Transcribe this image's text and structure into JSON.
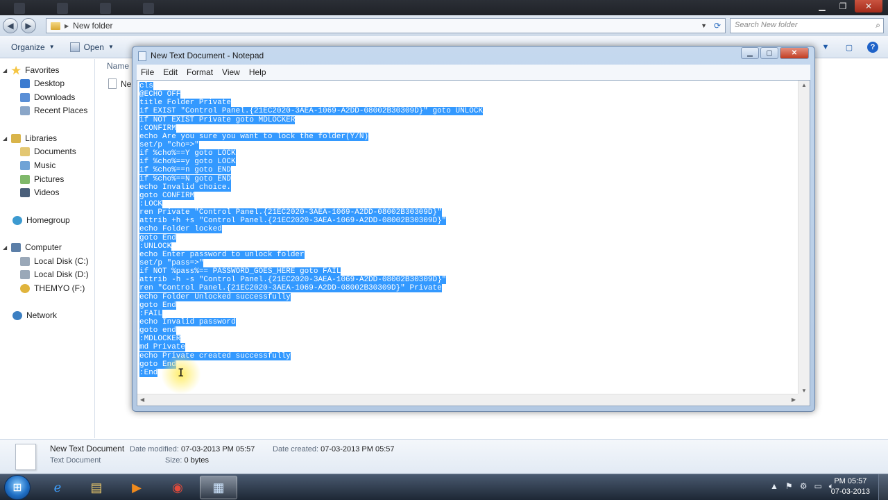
{
  "explorer": {
    "address_path": "New folder",
    "search_placeholder": "Search New folder",
    "toolbar": {
      "organize": "Organize",
      "open": "Open"
    },
    "column_header": "Name",
    "file_name": "Ne",
    "nav": {
      "favorites": "Favorites",
      "desktop": "Desktop",
      "downloads": "Downloads",
      "recent_places": "Recent Places",
      "libraries": "Libraries",
      "documents": "Documents",
      "music": "Music",
      "pictures": "Pictures",
      "videos": "Videos",
      "homegroup": "Homegroup",
      "computer": "Computer",
      "local_disk_c": "Local Disk (C:)",
      "local_disk_d": "Local Disk (D:)",
      "themyo_f": "THEMYO (F:)",
      "network": "Network"
    },
    "details": {
      "name": "New Text Document",
      "type": "Text Document",
      "date_modified_label": "Date modified:",
      "date_modified": "07-03-2013 PM 05:57",
      "date_created_label": "Date created:",
      "date_created": "07-03-2013 PM 05:57",
      "size_label": "Size:",
      "size": "0 bytes"
    }
  },
  "notepad": {
    "title": "New Text Document - Notepad",
    "menu": {
      "file": "File",
      "edit": "Edit",
      "format": "Format",
      "view": "View",
      "help": "Help"
    },
    "lines": [
      "cls",
      "@ECHO OFF",
      "title Folder Private",
      "if EXIST \"Control Panel.{21EC2020-3AEA-1069-A2DD-08002B30309D}\" goto UNLOCK",
      "if NOT EXIST Private goto MDLOCKER",
      ":CONFIRM",
      "echo Are you sure you want to lock the folder(Y/N)",
      "set/p \"cho=>\"",
      "if %cho%==Y goto LOCK",
      "if %cho%==y goto LOCK",
      "if %cho%==n goto END",
      "if %cho%==N goto END",
      "echo Invalid choice.",
      "goto CONFIRM",
      ":LOCK",
      "ren Private \"Control Panel.{21EC2020-3AEA-1069-A2DD-08002B30309D}\"",
      "attrib +h +s \"Control Panel.{21EC2020-3AEA-1069-A2DD-08002B30309D}\"",
      "echo Folder locked",
      "goto End",
      ":UNLOCK",
      "echo Enter password to unlock folder",
      "set/p \"pass=>\"",
      "if NOT %pass%== PASSWORD_GOES_HERE goto FAIL",
      "attrib -h -s \"Control Panel.{21EC2020-3AEA-1069-A2DD-08002B30309D}\"",
      "ren \"Control Panel.{21EC2020-3AEA-1069-A2DD-08002B30309D}\" Private",
      "echo Folder Unlocked successfully",
      "goto End",
      ":FAIL",
      "echo Invalid password",
      "goto end",
      ":MDLOCKER",
      "md Private",
      "echo Private created successfully",
      "goto End",
      ":End"
    ]
  },
  "taskbar": {
    "clock_time": "PM 05:57",
    "clock_date": "07-03-2013"
  },
  "colors": {
    "selection": "#3399ff",
    "accent": "#1e62c8"
  }
}
